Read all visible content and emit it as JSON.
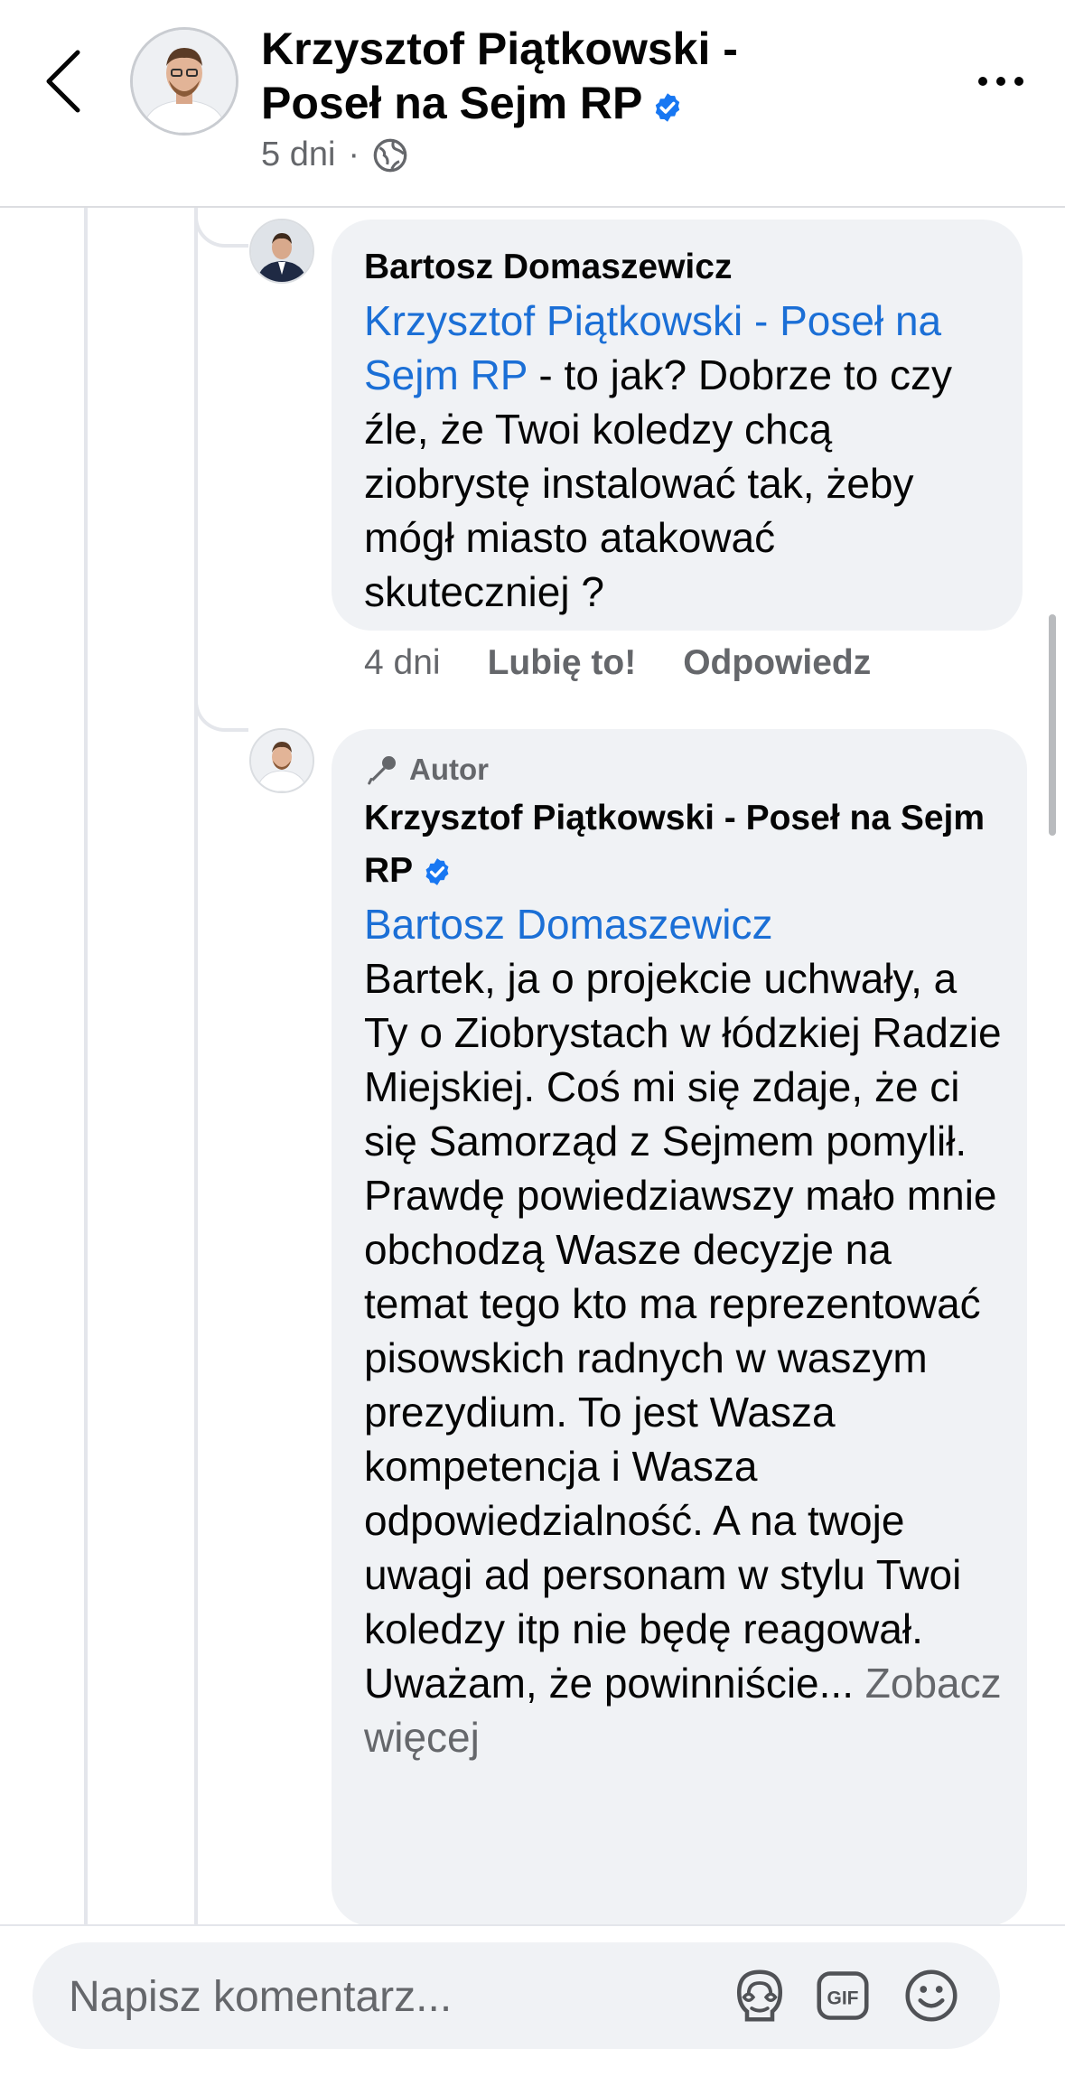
{
  "header": {
    "page_name": "Krzysztof Piątkowski - Poseł na Sejm RP",
    "time": "5 dni",
    "separator": "·"
  },
  "comments": [
    {
      "author": "Bartosz Domaszewicz",
      "mention": "Krzysztof Piątkowski - Poseł na Sejm RP",
      "text": " - to jak? Dobrze to czy źle, że Twoi koledzy chcą ziobrystę instalować tak, żeby mógł miasto atakować skuteczniej ?",
      "time": "4 dni",
      "like_label": "Lubię to!",
      "reply_label": "Odpowiedz"
    },
    {
      "badge": "Autor",
      "author": "Krzysztof Piątkowski - Poseł na Sejm RP",
      "mention": "Bartosz Domaszewicz",
      "text": "Bartek, ja o projekcie uchwały, a Ty o Ziobrystach w łódzkiej Radzie Miejskiej. Coś mi się zdaje, że ci się Samorząd z Sejmem pomylił. Prawdę powiedziawszy mało mnie obchodzą Wasze decyzje na temat tego kto ma reprezentować pisowskich radnych w waszym prezydium. To jest Wasza kompetencja i Wasza odpowiedzialność.  A na twoje uwagi ad personam w stylu Twoi koledzy itp nie będę reagował. Uważam, że powinniście...",
      "see_more": "Zobacz więcej"
    }
  ],
  "composer": {
    "placeholder": "Napisz komentarz..."
  },
  "icons": {
    "back": "chevron-left-icon",
    "more": "more-horizontal-icon",
    "audience": "globe-icon",
    "verified": "verified-badge-icon",
    "author_badge": "microphone-icon",
    "avatar_sticker": "avatar-sticker-icon",
    "gif": "gif-icon",
    "emoji": "emoji-icon"
  },
  "colors": {
    "link": "#1b6fd6",
    "verified": "#1877f2",
    "secondary_text": "#65676b",
    "bubble": "#f0f2f5"
  }
}
